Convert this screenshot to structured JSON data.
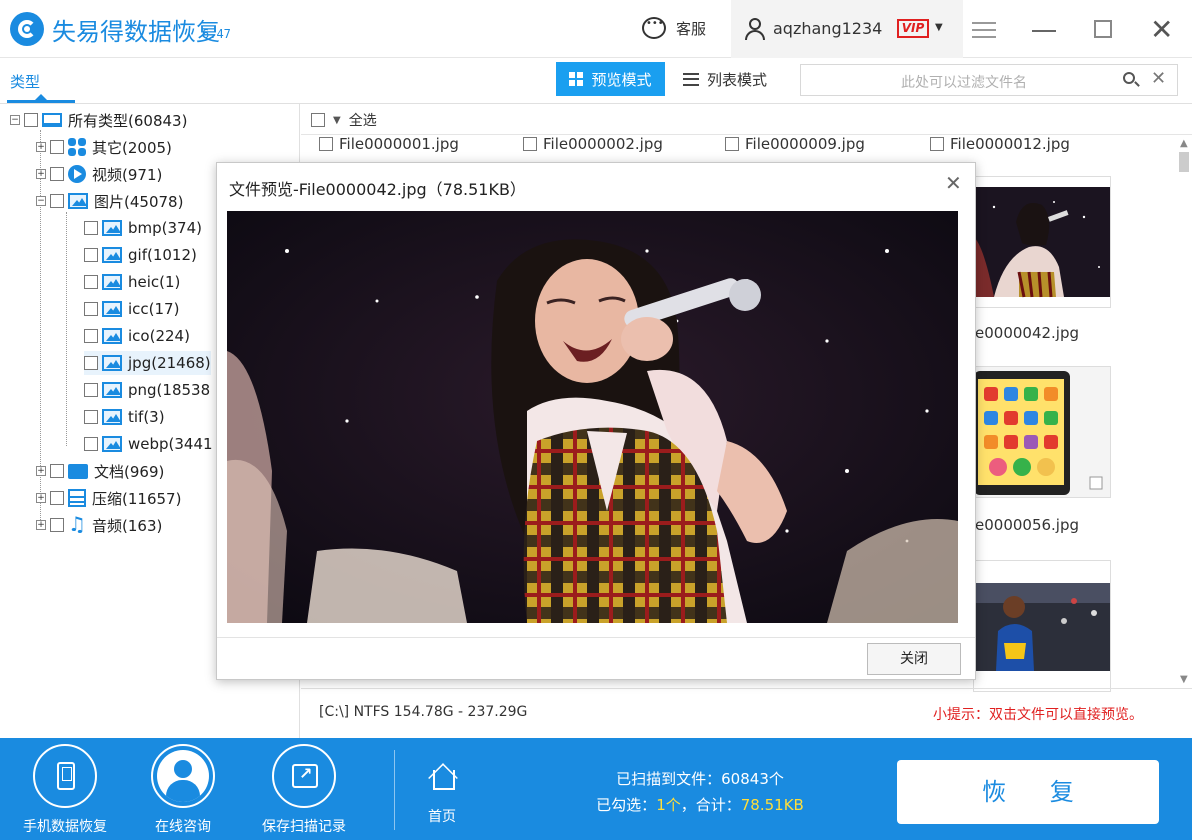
{
  "app": {
    "title": "失易得数据恢复",
    "version": "6.47"
  },
  "header": {
    "support_label": "客服",
    "username": "aqzhang1234",
    "vip_label": "VIP"
  },
  "toolbar": {
    "type_tab": "类型",
    "preview_mode": "预览模式",
    "list_mode": "列表模式",
    "filter_placeholder": "此处可以过滤文件名"
  },
  "tree": {
    "root": "所有类型(60843)",
    "items": [
      {
        "label": "其它(2005)",
        "icon": "other-icon"
      },
      {
        "label": "视频(971)",
        "icon": "video-icon"
      },
      {
        "label": "图片(45078)",
        "icon": "image-icon"
      },
      {
        "label": "bmp(374)",
        "icon": "image-icon"
      },
      {
        "label": "gif(1012)",
        "icon": "image-icon"
      },
      {
        "label": "heic(1)",
        "icon": "image-icon"
      },
      {
        "label": "icc(17)",
        "icon": "image-icon"
      },
      {
        "label": "ico(224)",
        "icon": "image-icon"
      },
      {
        "label": "jpg(21468)",
        "icon": "image-icon"
      },
      {
        "label": "png(18538",
        "icon": "image-icon"
      },
      {
        "label": "tif(3)",
        "icon": "image-icon"
      },
      {
        "label": "webp(3441",
        "icon": "image-icon"
      },
      {
        "label": "文档(969)",
        "icon": "folder-icon"
      },
      {
        "label": "压缩(11657)",
        "icon": "zip-icon"
      },
      {
        "label": "音频(163)",
        "icon": "music-icon"
      }
    ]
  },
  "content": {
    "select_all": "全选",
    "top_files": [
      "File0000001.jpg",
      "File0000002.jpg",
      "File0000009.jpg",
      "File0000012.jpg"
    ],
    "right_files": [
      "e0000042.jpg",
      "e0000056.jpg"
    ],
    "status_left": "[C:\\] NTFS 154.78G - 237.29G",
    "tip": "小提示：双击文件可以直接预览。"
  },
  "dialog": {
    "title": "文件预览-File0000042.jpg（78.51KB）",
    "close_button": "关闭"
  },
  "bottom": {
    "phone_recovery": "手机数据恢复",
    "online_consult": "在线咨询",
    "save_scan": "保存扫描记录",
    "home": "首页",
    "scanned_label": "已扫描到文件：60843个",
    "selected_prefix": "已勾选：",
    "selected_count": "1个",
    "total_prefix": "，合计：",
    "selected_size": "78.51KB",
    "recover_button": "恢 复"
  },
  "colors": {
    "accent": "#1a8be0",
    "warning": "#e02020",
    "highlight": "#ffde3a"
  }
}
